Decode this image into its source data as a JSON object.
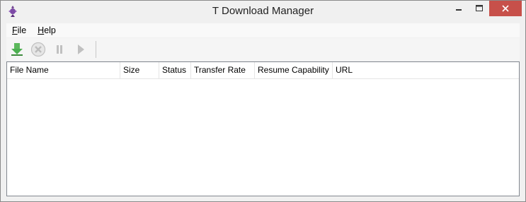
{
  "window": {
    "title": "T Download Manager",
    "close_color": "#c7504a"
  },
  "menu": {
    "file_label": "File",
    "help_label": "Help"
  },
  "toolbar": {
    "buttons": [
      {
        "name": "download",
        "icon": "download-arrow-icon",
        "color": "#4caf50"
      },
      {
        "name": "cancel",
        "icon": "cancel-circle-icon",
        "color": "#c0c0c0"
      },
      {
        "name": "pause",
        "icon": "pause-icon",
        "color": "#c0c0c0"
      },
      {
        "name": "resume",
        "icon": "play-icon",
        "color": "#c0c0c0"
      }
    ]
  },
  "list": {
    "columns": [
      "File Name",
      "Size",
      "Status",
      "Transfer Rate",
      "Resume Capability",
      "URL"
    ],
    "rows": []
  }
}
